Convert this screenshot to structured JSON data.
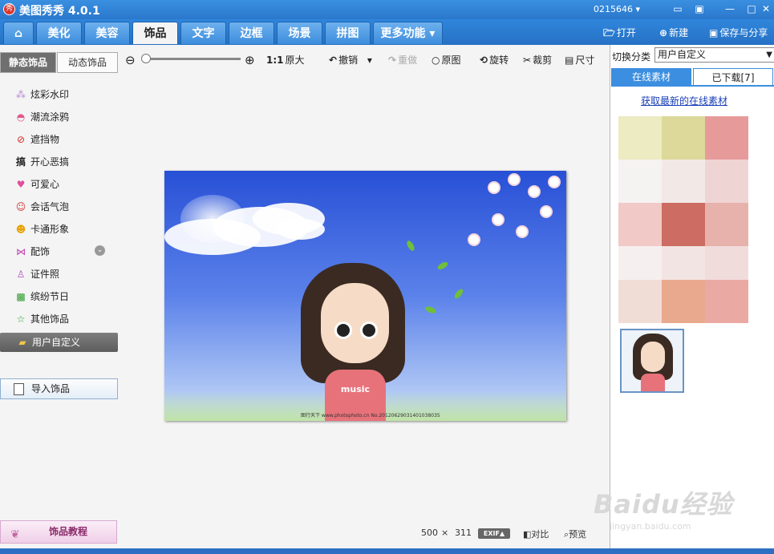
{
  "titlebar": {
    "logo_text": "秀",
    "title": "美图秀秀 4.0.1",
    "user": "0215646",
    "user_caret": "▾"
  },
  "tabs": [
    {
      "label": "美化"
    },
    {
      "label": "美容"
    },
    {
      "label": "饰品",
      "active": true
    },
    {
      "label": "文字"
    },
    {
      "label": "边框"
    },
    {
      "label": "场景"
    },
    {
      "label": "拼图"
    },
    {
      "label": "更多功能 ▾"
    }
  ],
  "file_actions": {
    "open": "打开",
    "new": "新建",
    "save_share": "保存与分享"
  },
  "subtabs": {
    "static": "静态饰品",
    "dynamic": "动态饰品"
  },
  "toolbar": {
    "original_size_icon": "1:1",
    "original_size": "原大",
    "undo": "撤销",
    "redo": "重做",
    "original": "原图",
    "rotate": "旋转",
    "crop": "裁剪",
    "size": "尺寸"
  },
  "sidebar": {
    "items": [
      {
        "label": "炫彩水印",
        "icon": "sparkle-icon"
      },
      {
        "label": "潮流涂鸦",
        "icon": "lips-icon"
      },
      {
        "label": "遮挡物",
        "icon": "block-icon"
      },
      {
        "label": "开心恶搞",
        "icon": "prank-icon"
      },
      {
        "label": "可爱心",
        "icon": "heart-icon"
      },
      {
        "label": "会话气泡",
        "icon": "speech-bubble-icon"
      },
      {
        "label": "卡通形象",
        "icon": "cartoon-icon"
      },
      {
        "label": "配饰",
        "icon": "bow-icon"
      },
      {
        "label": "证件照",
        "icon": "shirt-icon"
      },
      {
        "label": "缤纷节日",
        "icon": "gift-icon"
      },
      {
        "label": "其他饰品",
        "icon": "star-icon"
      },
      {
        "label": "用户自定义",
        "icon": "folder-icon",
        "selected": true
      }
    ],
    "import_button": "导入饰品",
    "tutorial_button": "饰品教程"
  },
  "canvas": {
    "shirt_text": "music",
    "watermark": "图行天下 www.photophoto.cn No.20120629031401038035"
  },
  "statusbar": {
    "width": "500",
    "times": "×",
    "height": "311",
    "exif": "EXIF▲",
    "compare": "对比",
    "preview": "预览"
  },
  "rightpanel": {
    "switch_label": "切换分类",
    "switch_value": "用户自定义",
    "tab_online": "在线素材",
    "tab_downloaded": "已下载[7]",
    "fetch_link": "获取最新的在线素材"
  },
  "baidu_watermark": {
    "big": "Baidu经验",
    "small": "jingyan.baidu.com"
  }
}
